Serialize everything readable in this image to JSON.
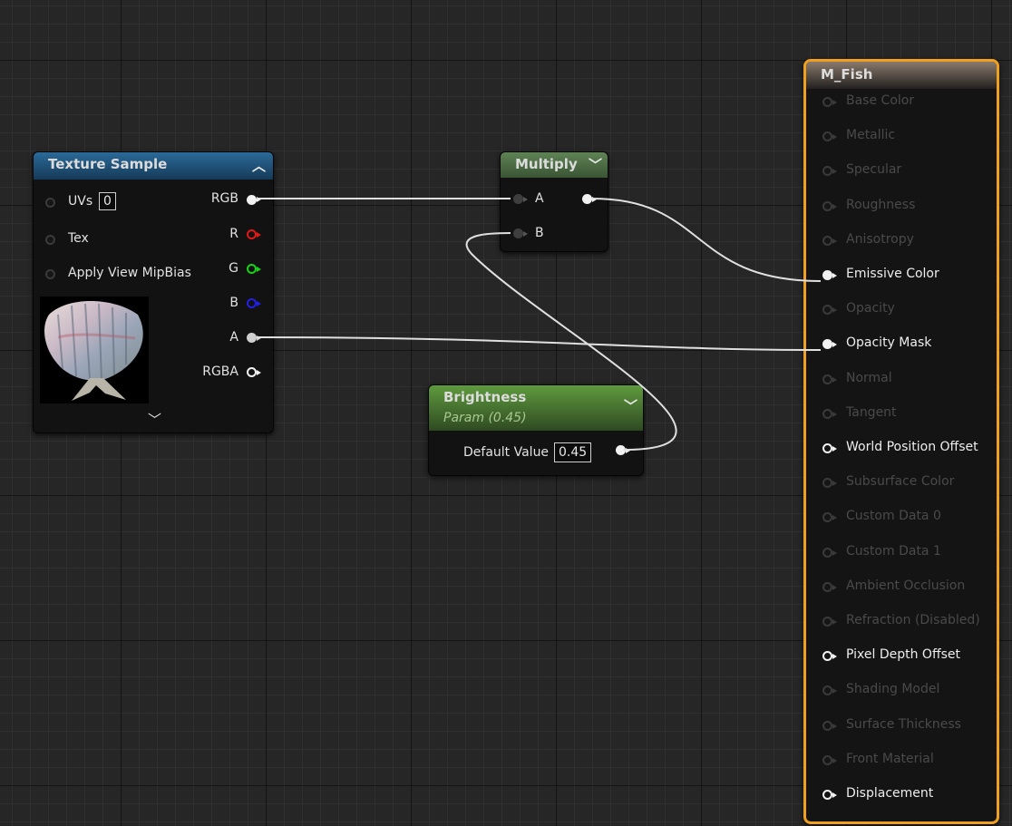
{
  "texture_sample": {
    "title": "Texture Sample",
    "inputs": [
      {
        "label": "UVs",
        "value": "0"
      },
      {
        "label": "Tex"
      },
      {
        "label": "Apply View MipBias"
      }
    ],
    "outputs": [
      "RGB",
      "R",
      "G",
      "B",
      "A",
      "RGBA"
    ]
  },
  "multiply": {
    "title": "Multiply",
    "inputs": [
      "A",
      "B"
    ]
  },
  "brightness": {
    "title": "Brightness",
    "subtitle": "Param (0.45)",
    "default_label": "Default Value",
    "default_value": "0.45"
  },
  "material": {
    "title": "M_Fish",
    "pins": [
      {
        "label": "Base Color",
        "enabled": false
      },
      {
        "label": "Metallic",
        "enabled": false
      },
      {
        "label": "Specular",
        "enabled": false
      },
      {
        "label": "Roughness",
        "enabled": false
      },
      {
        "label": "Anisotropy",
        "enabled": false
      },
      {
        "label": "Emissive Color",
        "enabled": true,
        "connected": true
      },
      {
        "label": "Opacity",
        "enabled": false
      },
      {
        "label": "Opacity Mask",
        "enabled": true,
        "connected": true
      },
      {
        "label": "Normal",
        "enabled": false
      },
      {
        "label": "Tangent",
        "enabled": false
      },
      {
        "label": "World Position Offset",
        "enabled": true,
        "connected": false
      },
      {
        "label": "Subsurface Color",
        "enabled": false
      },
      {
        "label": "Custom Data 0",
        "enabled": false
      },
      {
        "label": "Custom Data 1",
        "enabled": false
      },
      {
        "label": "Ambient Occlusion",
        "enabled": false
      },
      {
        "label": "Refraction (Disabled)",
        "enabled": false
      },
      {
        "label": "Pixel Depth Offset",
        "enabled": true,
        "connected": false
      },
      {
        "label": "Shading Model",
        "enabled": false
      },
      {
        "label": "Surface Thickness",
        "enabled": false
      },
      {
        "label": "Front Material",
        "enabled": false
      },
      {
        "label": "Displacement",
        "enabled": true,
        "connected": false
      }
    ]
  },
  "colors": {
    "texture_header": "#1f4f74",
    "multiply_header": "#4a6a42",
    "brightness_header": "#4d7a33",
    "material_border": "#f0a020",
    "wire": "#e0e0e0"
  }
}
